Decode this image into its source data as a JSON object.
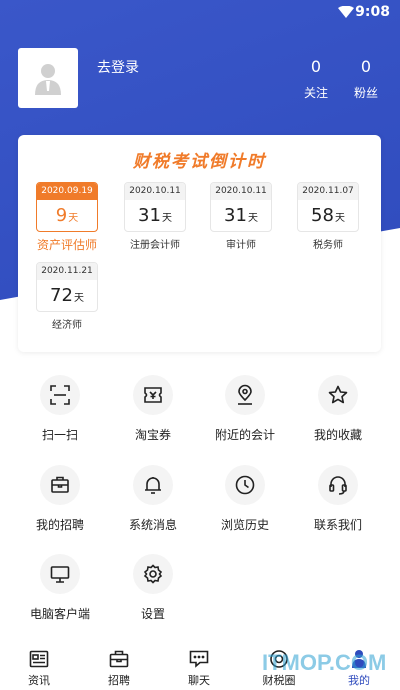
{
  "status": {
    "time": "9:08"
  },
  "profile": {
    "login_label": "去登录"
  },
  "stats": [
    {
      "value": "0",
      "label": "关注"
    },
    {
      "value": "0",
      "label": "粉丝"
    }
  ],
  "countdown": {
    "title": "财税考试倒计时",
    "items": [
      {
        "date": "2020.09.19",
        "days": "9",
        "unit": "天",
        "name": "资产评估师",
        "active": true
      },
      {
        "date": "2020.10.11",
        "days": "31",
        "unit": "天",
        "name": "注册会计师"
      },
      {
        "date": "2020.10.11",
        "days": "31",
        "unit": "天",
        "name": "审计师"
      },
      {
        "date": "2020.11.07",
        "days": "58",
        "unit": "天",
        "name": "税务师"
      },
      {
        "date": "2020.11.21",
        "days": "72",
        "unit": "天",
        "name": "经济师"
      }
    ]
  },
  "menu": [
    {
      "label": "扫一扫",
      "icon": "scan-icon"
    },
    {
      "label": "淘宝券",
      "icon": "coupon-icon"
    },
    {
      "label": "附近的会计",
      "icon": "location-pin-icon"
    },
    {
      "label": "我的收藏",
      "icon": "star-icon"
    },
    {
      "label": "我的招聘",
      "icon": "briefcase-icon"
    },
    {
      "label": "系统消息",
      "icon": "bell-icon"
    },
    {
      "label": "浏览历史",
      "icon": "clock-icon"
    },
    {
      "label": "联系我们",
      "icon": "headset-icon"
    },
    {
      "label": "电脑客户端",
      "icon": "monitor-icon"
    },
    {
      "label": "设置",
      "icon": "gear-icon"
    }
  ],
  "tabs": [
    {
      "label": "资讯",
      "icon": "news-icon"
    },
    {
      "label": "招聘",
      "icon": "briefcase-icon"
    },
    {
      "label": "聊天",
      "icon": "chat-icon"
    },
    {
      "label": "财税圈",
      "icon": "circle-icon"
    },
    {
      "label": "我的",
      "icon": "person-icon",
      "active": true
    }
  ],
  "watermark": "ITMOP.COM",
  "colors": {
    "primary": "#2f4bbd",
    "accent": "#f07b2a"
  }
}
